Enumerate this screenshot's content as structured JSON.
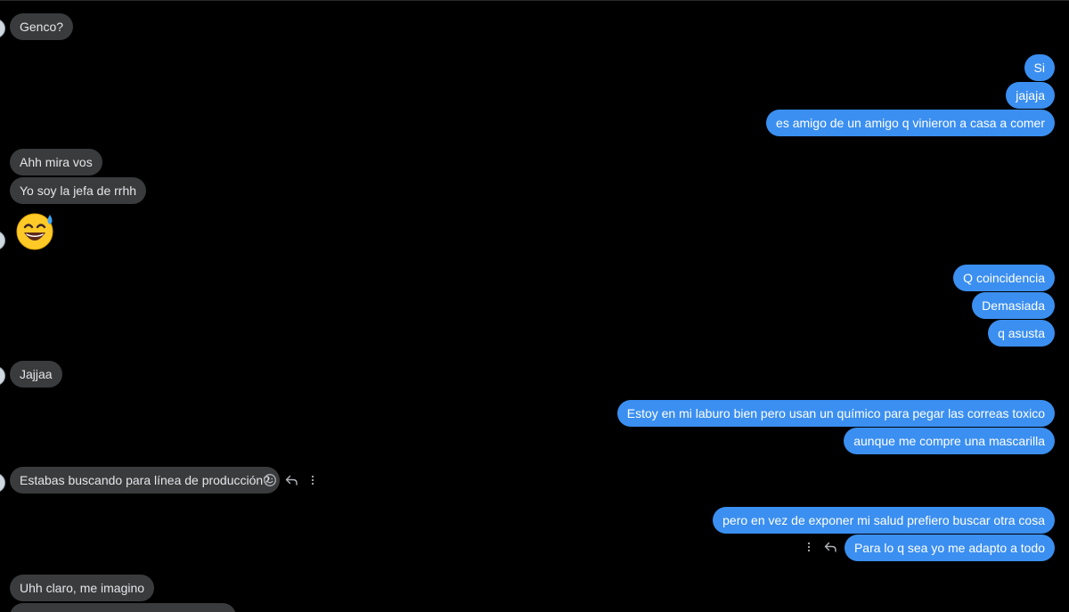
{
  "messages": [
    {
      "text": "Genco?"
    },
    {
      "text": "Si"
    },
    {
      "text": "jajaja"
    },
    {
      "text": "es amigo de un amigo q vinieron a casa a comer"
    },
    {
      "text": "Ahh mira vos"
    },
    {
      "text": "Yo soy la jefa de rrhh"
    },
    {
      "text": "Q coincidencia"
    },
    {
      "text": "Demasiada"
    },
    {
      "text": "q asusta"
    },
    {
      "text": "Jajjaa"
    },
    {
      "text": "Estoy en mi laburo bien pero usan un químico para pegar las correas toxico"
    },
    {
      "text": "aunque me compre una mascarilla"
    },
    {
      "text": "Estabas buscando para línea de producción?"
    },
    {
      "text": "pero en vez de exponer mi salud prefiero buscar otra cosa"
    },
    {
      "text": "Para lo q sea yo me adapto a todo"
    },
    {
      "text": "Uhh claro, me imagino"
    }
  ],
  "emoji": {
    "name": "grinning-face-with-sweat-icon"
  },
  "colors": {
    "background": "#000000",
    "incoming_bubble": "#3a3b3c",
    "outgoing_bubble": "#3b8ff0"
  }
}
